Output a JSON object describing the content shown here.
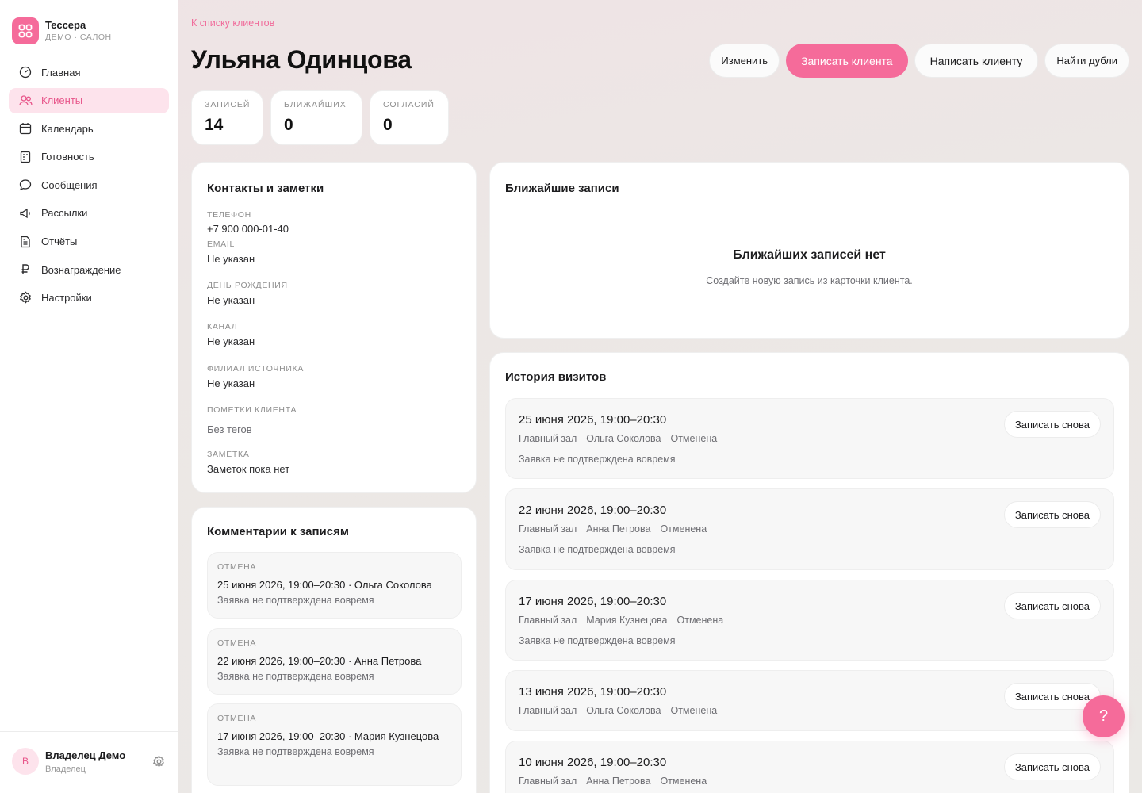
{
  "brand": {
    "name": "Тессера",
    "subtitle": "ДЕМО · САЛОН"
  },
  "nav": [
    {
      "label": "Главная",
      "icon": "gauge-icon",
      "active": false
    },
    {
      "label": "Клиенты",
      "icon": "users-icon",
      "active": true
    },
    {
      "label": "Календарь",
      "icon": "calendar-icon",
      "active": false
    },
    {
      "label": "Готовность",
      "icon": "checklist-icon",
      "active": false
    },
    {
      "label": "Сообщения",
      "icon": "chat-icon",
      "active": false
    },
    {
      "label": "Рассылки",
      "icon": "megaphone-icon",
      "active": false
    },
    {
      "label": "Отчёты",
      "icon": "report-icon",
      "active": false
    },
    {
      "label": "Вознаграждение",
      "icon": "ruble-icon",
      "active": false
    },
    {
      "label": "Настройки",
      "icon": "gear-icon",
      "active": false
    }
  ],
  "user": {
    "initial": "В",
    "name": "Владелец Демо",
    "role": "Владелец"
  },
  "back_link": "К списку клиентов",
  "client_name": "Ульяна Одинцова",
  "actions": {
    "edit": "Изменить",
    "book": "Записать клиента",
    "message": "Написать клиенту",
    "duplicates": "Найти дубли"
  },
  "stats": [
    {
      "label": "ЗАПИСЕЙ",
      "value": "14"
    },
    {
      "label": "БЛИЖАЙШИХ",
      "value": "0"
    },
    {
      "label": "СОГЛАСИЙ",
      "value": "0"
    }
  ],
  "contacts": {
    "title": "Контакты и заметки",
    "phone_label": "ТЕЛЕФОН",
    "phone": "+7 900 000-01-40",
    "email_label": "EMAIL",
    "email": "Не указан",
    "birthday_label": "ДЕНЬ РОЖДЕНИЯ",
    "birthday": "Не указан",
    "channel_label": "КАНАЛ",
    "channel": "Не указан",
    "branch_label": "ФИЛИАЛ ИСТОЧНИКА",
    "branch": "Не указан",
    "tags_label": "ПОМЕТКИ КЛИЕНТА",
    "tags": "Без тегов",
    "note_label": "ЗАМЕТКА",
    "note": "Заметок пока нет"
  },
  "comments": {
    "title": "Комментарии к записям",
    "items": [
      {
        "kind": "ОТМЕНА",
        "head": "25 июня 2026, 19:00–20:30 · Ольга Соколова",
        "text": "Заявка не подтверждена вовремя"
      },
      {
        "kind": "ОТМЕНА",
        "head": "22 июня 2026, 19:00–20:30 · Анна Петрова",
        "text": "Заявка не подтверждена вовремя"
      },
      {
        "kind": "ОТМЕНА",
        "head": "17 июня 2026, 19:00–20:30 · Мария Кузнецова",
        "text": "Заявка не подтверждена вовремя"
      }
    ]
  },
  "upcoming": {
    "title": "Ближайшие записи",
    "empty_title": "Ближайших записей нет",
    "empty_sub": "Создайте новую запись из карточки клиента."
  },
  "history": {
    "title": "История визитов",
    "rebook_label": "Записать снова",
    "items": [
      {
        "date": "25 июня 2026, 19:00–20:30",
        "room": "Главный зал",
        "master": "Ольга Соколова",
        "status": "Отменена",
        "note": "Заявка не подтверждена вовремя"
      },
      {
        "date": "22 июня 2026, 19:00–20:30",
        "room": "Главный зал",
        "master": "Анна Петрова",
        "status": "Отменена",
        "note": "Заявка не подтверждена вовремя"
      },
      {
        "date": "17 июня 2026, 19:00–20:30",
        "room": "Главный зал",
        "master": "Мария Кузнецова",
        "status": "Отменена",
        "note": "Заявка не подтверждена вовремя"
      },
      {
        "date": "13 июня 2026, 19:00–20:30",
        "room": "Главный зал",
        "master": "Ольга Соколова",
        "status": "Отменена",
        "note": ""
      },
      {
        "date": "10 июня 2026, 19:00–20:30",
        "room": "Главный зал",
        "master": "Анна Петрова",
        "status": "Отменена",
        "note": ""
      }
    ]
  },
  "help_label": "?",
  "colors": {
    "accent": "#f56b9a",
    "accent_soft": "#fde3ec",
    "accent_text": "#e8558a"
  }
}
